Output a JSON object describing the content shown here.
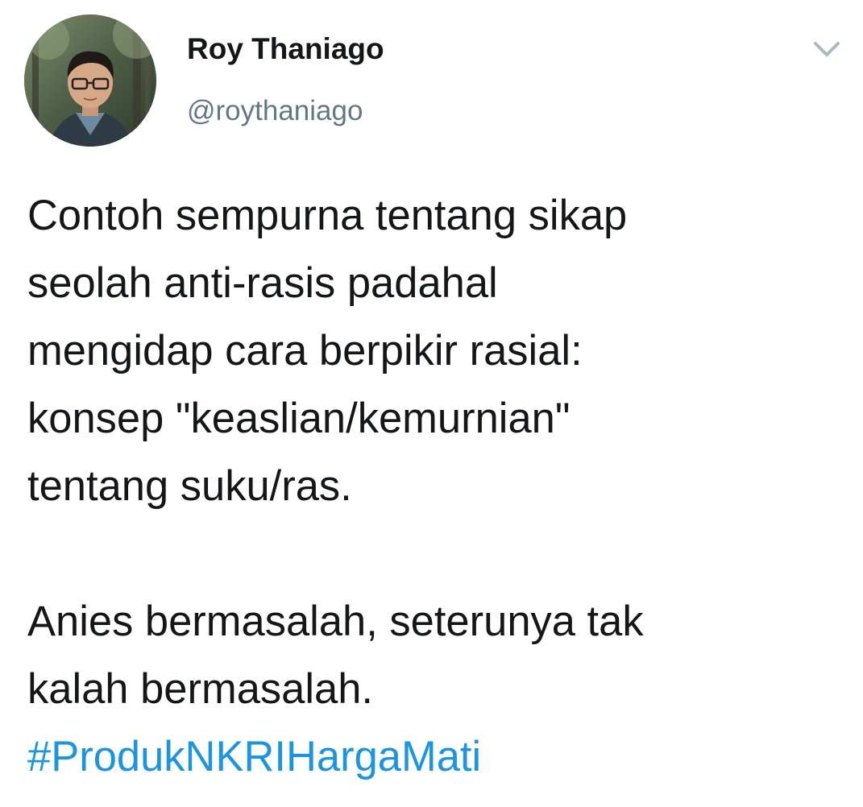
{
  "author": {
    "display_name": "Roy Thaniago",
    "handle": "@roythaniago",
    "avatar_icon": "profile-photo"
  },
  "menu": {
    "icon": "chevron-down-icon"
  },
  "tweet": {
    "lines": [
      "Contoh sempurna tentang sikap",
      "seolah anti-rasis padahal",
      "mengidap cara berpikir rasial:",
      "konsep \"keaslian/kemurnian\"",
      "tentang suku/ras."
    ],
    "lines2": [
      "Anies bermasalah, seterunya tak",
      "kalah bermasalah."
    ],
    "hashtag": "#ProdukNKRIHargaMati"
  },
  "colors": {
    "text": "#14171a",
    "secondary": "#657786",
    "link": "#1b95e0",
    "caret": "#aab8c2"
  }
}
